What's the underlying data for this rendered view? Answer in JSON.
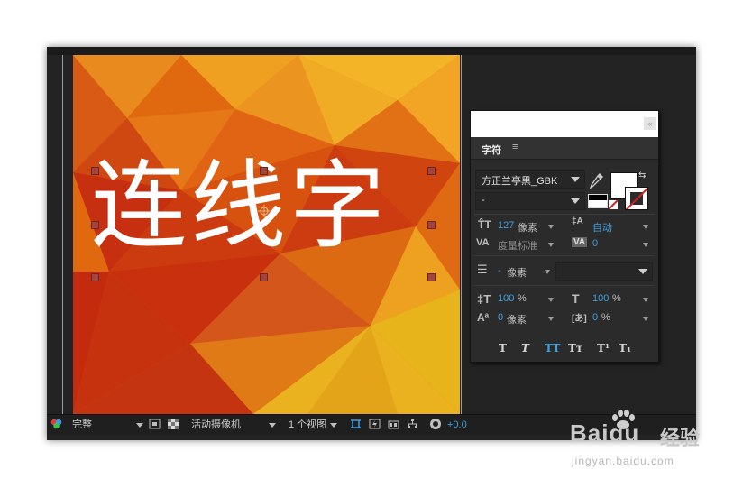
{
  "canvas": {
    "text": "连线字"
  },
  "character_panel": {
    "tab_title": "字符",
    "menu_icon": "≡",
    "close_icon": "«",
    "font_family": "方正兰亭黑_GBK",
    "font_style": "-",
    "font_size_value": "127",
    "font_size_unit": "像素",
    "leading_value": "自动",
    "kerning_value": "度量标准",
    "tracking_value": "0",
    "stroke_width_value": "-",
    "stroke_width_unit": "像素",
    "vertical_scale_value": "100",
    "vertical_scale_unit": "%",
    "horizontal_scale_value": "100",
    "horizontal_scale_unit": "%",
    "baseline_shift_value": "0",
    "baseline_shift_unit": "像素",
    "tsume_value": "0",
    "tsume_unit": "%",
    "fill_color": "#ffffff",
    "stroke_color": "#ffffff",
    "style_buttons": [
      "T",
      "T",
      "TT",
      "Tт",
      "T¹",
      "T₁"
    ]
  },
  "bottom_bar": {
    "resolution": "完整",
    "camera": "活动摄像机",
    "views": "1 个视图",
    "exposure": "+0.0"
  },
  "watermark": {
    "logo": "Baidu",
    "service": "经验",
    "url": "jingyan.baidu.com"
  },
  "colors": {
    "accent_blue": "#3d9fe0",
    "panel_bg": "#2b2b2b",
    "handle": "#a1433e"
  }
}
